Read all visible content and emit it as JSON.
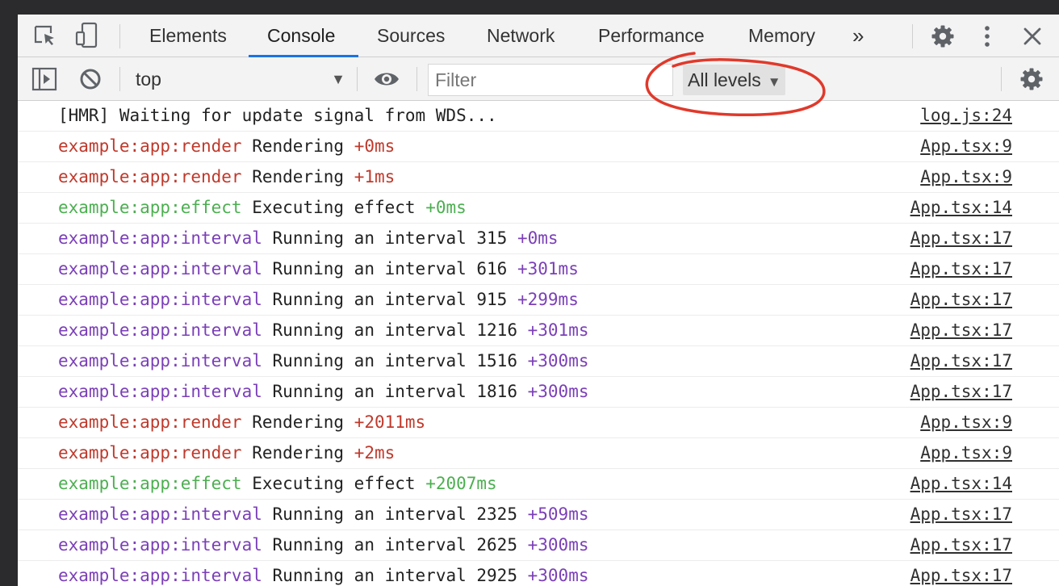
{
  "tabs": {
    "items": [
      {
        "label": "Elements",
        "active": false
      },
      {
        "label": "Console",
        "active": true
      },
      {
        "label": "Sources",
        "active": false
      },
      {
        "label": "Network",
        "active": false
      },
      {
        "label": "Performance",
        "active": false
      },
      {
        "label": "Memory",
        "active": false
      }
    ],
    "more": "»"
  },
  "toolbar": {
    "context": "top",
    "filter_placeholder": "Filter",
    "levels_label": "All levels"
  },
  "colors": {
    "render": "#c0392b",
    "effect": "#4caf50",
    "interval": "#7b3fb8",
    "accent": "#1a73e8",
    "annotation": "#e0392b"
  },
  "log": [
    {
      "plain": "[HMR] Waiting for update signal from WDS...",
      "source": "log.js:24"
    },
    {
      "ns": "example:app:render",
      "text": "Rendering",
      "delta": "+0ms",
      "kind": "render",
      "source": "App.tsx:9"
    },
    {
      "ns": "example:app:render",
      "text": "Rendering",
      "delta": "+1ms",
      "kind": "render",
      "source": "App.tsx:9"
    },
    {
      "ns": "example:app:effect",
      "text": "Executing effect",
      "delta": "+0ms",
      "kind": "effect",
      "source": "App.tsx:14"
    },
    {
      "ns": "example:app:interval",
      "text": "Running an interval 315",
      "delta": "+0ms",
      "kind": "interval",
      "source": "App.tsx:17"
    },
    {
      "ns": "example:app:interval",
      "text": "Running an interval 616",
      "delta": "+301ms",
      "kind": "interval",
      "source": "App.tsx:17"
    },
    {
      "ns": "example:app:interval",
      "text": "Running an interval 915",
      "delta": "+299ms",
      "kind": "interval",
      "source": "App.tsx:17"
    },
    {
      "ns": "example:app:interval",
      "text": "Running an interval 1216",
      "delta": "+301ms",
      "kind": "interval",
      "source": "App.tsx:17"
    },
    {
      "ns": "example:app:interval",
      "text": "Running an interval 1516",
      "delta": "+300ms",
      "kind": "interval",
      "source": "App.tsx:17"
    },
    {
      "ns": "example:app:interval",
      "text": "Running an interval 1816",
      "delta": "+300ms",
      "kind": "interval",
      "source": "App.tsx:17"
    },
    {
      "ns": "example:app:render",
      "text": "Rendering",
      "delta": "+2011ms",
      "kind": "render",
      "source": "App.tsx:9"
    },
    {
      "ns": "example:app:render",
      "text": "Rendering",
      "delta": "+2ms",
      "kind": "render",
      "source": "App.tsx:9"
    },
    {
      "ns": "example:app:effect",
      "text": "Executing effect",
      "delta": "+2007ms",
      "kind": "effect",
      "source": "App.tsx:14"
    },
    {
      "ns": "example:app:interval",
      "text": "Running an interval 2325",
      "delta": "+509ms",
      "kind": "interval",
      "source": "App.tsx:17"
    },
    {
      "ns": "example:app:interval",
      "text": "Running an interval 2625",
      "delta": "+300ms",
      "kind": "interval",
      "source": "App.tsx:17"
    },
    {
      "ns": "example:app:interval",
      "text": "Running an interval 2925",
      "delta": "+300ms",
      "kind": "interval",
      "source": "App.tsx:17"
    }
  ]
}
